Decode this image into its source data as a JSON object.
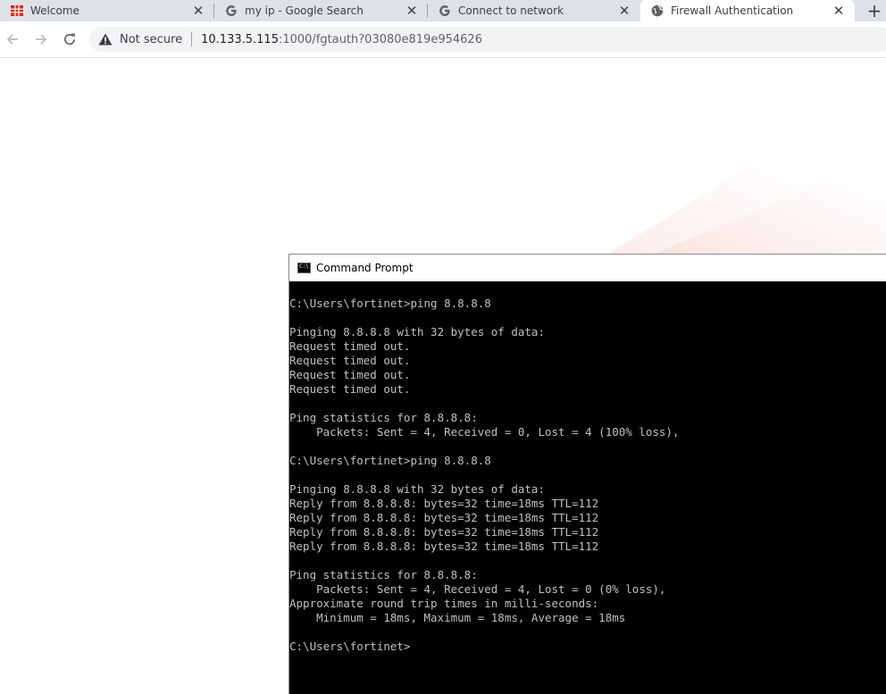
{
  "browser": {
    "tabs": [
      {
        "title": "Welcome",
        "favicon": "fortinet-icon"
      },
      {
        "title": "my ip - Google Search",
        "favicon": "google-icon"
      },
      {
        "title": "Connect to network",
        "favicon": "google-icon"
      },
      {
        "title": "Firewall Authentication",
        "favicon": "globe-icon",
        "active": true
      }
    ],
    "new_tab_label": "+",
    "address_bar": {
      "security_label": "Not secure",
      "url_host": "10.133.5.115",
      "url_path": ":1000/fgtauth?03080e819e954626"
    }
  },
  "cmd": {
    "title": "Command Prompt",
    "icon_text": "C:\\",
    "lines": [
      "C:\\Users\\fortinet>ping 8.8.8.8",
      "",
      "Pinging 8.8.8.8 with 32 bytes of data:",
      "Request timed out.",
      "Request timed out.",
      "Request timed out.",
      "Request timed out.",
      "",
      "Ping statistics for 8.8.8.8:",
      "    Packets: Sent = 4, Received = 0, Lost = 4 (100% loss),",
      "",
      "C:\\Users\\fortinet>ping 8.8.8.8",
      "",
      "Pinging 8.8.8.8 with 32 bytes of data:",
      "Reply from 8.8.8.8: bytes=32 time=18ms TTL=112",
      "Reply from 8.8.8.8: bytes=32 time=18ms TTL=112",
      "Reply from 8.8.8.8: bytes=32 time=18ms TTL=112",
      "Reply from 8.8.8.8: bytes=32 time=18ms TTL=112",
      "",
      "Ping statistics for 8.8.8.8:",
      "    Packets: Sent = 4, Received = 4, Lost = 0 (0% loss),",
      "Approximate round trip times in milli-seconds:",
      "    Minimum = 18ms, Maximum = 18ms, Average = 18ms",
      "",
      "C:\\Users\\fortinet>"
    ]
  },
  "colors": {
    "tabstrip": "#dee1e6",
    "console_bg": "#000000",
    "console_text": "#c0c0c0",
    "fortinet_red": "#da291c"
  }
}
